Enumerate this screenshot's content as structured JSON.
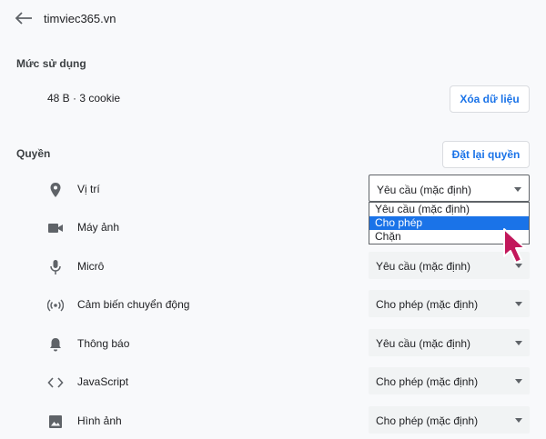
{
  "header": {
    "title": "timviec365.vn",
    "back_icon": "arrow-left-icon"
  },
  "usage": {
    "section_label": "Mức sử dụng",
    "summary": "48 B · 3 cookie",
    "clear_button": "Xóa dữ liệu"
  },
  "permissions": {
    "section_label": "Quyền",
    "reset_button": "Đặt lại quyền",
    "items": [
      {
        "label": "Vị trí",
        "icon": "location-pin-icon",
        "value": "Yêu cầu (mặc định)"
      },
      {
        "label": "Máy ảnh",
        "icon": "camera-icon",
        "value": ""
      },
      {
        "label": "Micrô",
        "icon": "microphone-icon",
        "value": "Yêu cầu (mặc định)"
      },
      {
        "label": "Cảm biến chuyển động",
        "icon": "motion-sensor-icon",
        "value": "Cho phép (mặc định)"
      },
      {
        "label": "Thông báo",
        "icon": "bell-icon",
        "value": "Yêu cầu (mặc định)"
      },
      {
        "label": "JavaScript",
        "icon": "code-icon",
        "value": "Cho phép (mặc định)"
      },
      {
        "label": "Hình ảnh",
        "icon": "image-icon",
        "value": "Cho phép (mặc định)"
      }
    ],
    "dropdown_options": [
      "Yêu cầu (mặc định)",
      "Cho phép",
      "Chặn"
    ],
    "highlighted_option": "Cho phép"
  },
  "colors": {
    "accent": "#1a73e8",
    "pointer": "#c2185b"
  }
}
